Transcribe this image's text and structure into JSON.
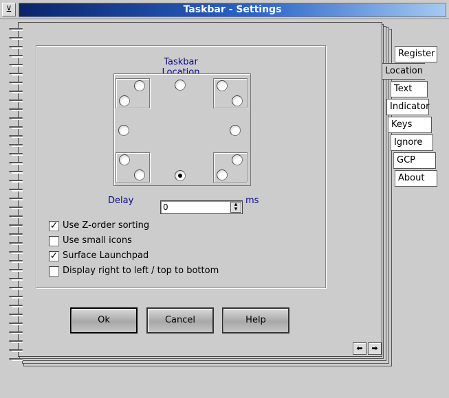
{
  "window": {
    "title": "Taskbar - Settings",
    "sysmenu_glyph": "⊻"
  },
  "tabs": [
    {
      "label": "Register",
      "active": false
    },
    {
      "label": "Location",
      "active": true
    },
    {
      "label": "Text",
      "active": false
    },
    {
      "label": "Indicator",
      "active": false
    },
    {
      "label": "Keys",
      "active": false
    },
    {
      "label": "Ignore",
      "active": false
    },
    {
      "label": "GCP",
      "active": false
    },
    {
      "label": "About",
      "active": false
    }
  ],
  "location": {
    "group_label": "Taskbar Location",
    "selected": "bottom-center"
  },
  "delay": {
    "label": "Delay",
    "value": "0",
    "unit": "ms"
  },
  "options": [
    {
      "label": "Use Z-order sorting",
      "checked": true
    },
    {
      "label": "Use small icons",
      "checked": false
    },
    {
      "label": "Surface Launchpad",
      "checked": true
    },
    {
      "label": "Display right to left / top to bottom",
      "checked": false
    }
  ],
  "buttons": {
    "ok": "Ok",
    "cancel": "Cancel",
    "help": "Help"
  },
  "nav": {
    "prev_glyph": "⬅",
    "next_glyph": "➡"
  }
}
